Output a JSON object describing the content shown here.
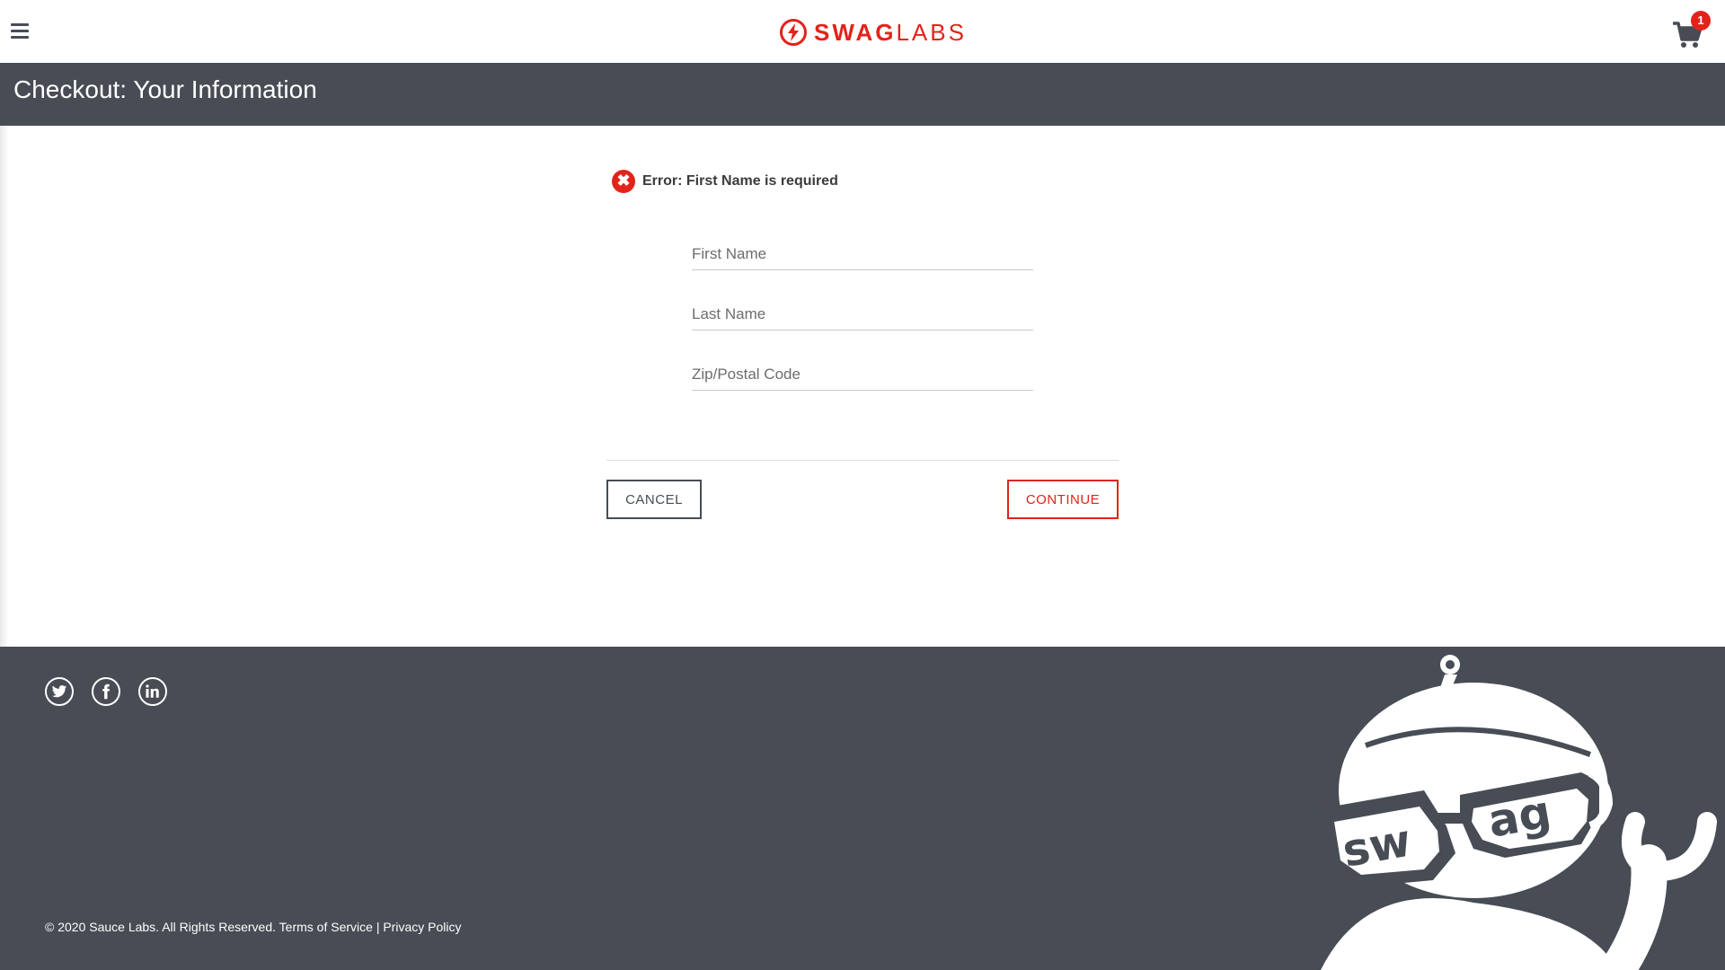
{
  "header": {
    "logo_bold": "SWAG",
    "logo_light": "LABS",
    "cart_count": "1"
  },
  "subheader": {
    "title": "Checkout: Your Information"
  },
  "form": {
    "error_message": "Error: First Name is required",
    "error_symbol": "✖",
    "first_name": {
      "placeholder": "First Name",
      "value": ""
    },
    "last_name": {
      "placeholder": "Last Name",
      "value": ""
    },
    "postal_code": {
      "placeholder": "Zip/Postal Code",
      "value": ""
    },
    "cancel_label": "CANCEL",
    "continue_label": "CONTINUE"
  },
  "footer": {
    "social": [
      "twitter-icon",
      "facebook-icon",
      "linkedin-icon"
    ],
    "copyright": "© 2020 Sauce Labs. All Rights Reserved.",
    "terms_label": "Terms of Service",
    "separator": "|",
    "privacy_label": "Privacy Policy",
    "mascot_text": "swag"
  },
  "colors": {
    "accent": "#e2231a",
    "dark": "#474c55",
    "background": "#ffffff"
  }
}
